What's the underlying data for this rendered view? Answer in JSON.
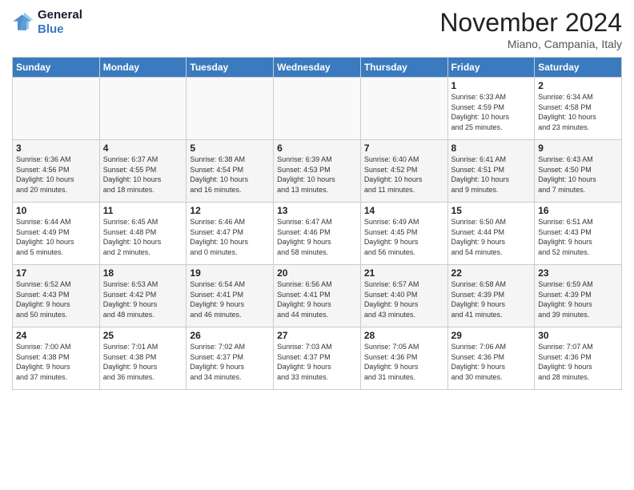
{
  "header": {
    "logo_line1": "General",
    "logo_line2": "Blue",
    "month_title": "November 2024",
    "location": "Miano, Campania, Italy"
  },
  "days_of_week": [
    "Sunday",
    "Monday",
    "Tuesday",
    "Wednesday",
    "Thursday",
    "Friday",
    "Saturday"
  ],
  "weeks": [
    [
      {
        "day": "",
        "info": ""
      },
      {
        "day": "",
        "info": ""
      },
      {
        "day": "",
        "info": ""
      },
      {
        "day": "",
        "info": ""
      },
      {
        "day": "",
        "info": ""
      },
      {
        "day": "1",
        "info": "Sunrise: 6:33 AM\nSunset: 4:59 PM\nDaylight: 10 hours\nand 25 minutes."
      },
      {
        "day": "2",
        "info": "Sunrise: 6:34 AM\nSunset: 4:58 PM\nDaylight: 10 hours\nand 23 minutes."
      }
    ],
    [
      {
        "day": "3",
        "info": "Sunrise: 6:36 AM\nSunset: 4:56 PM\nDaylight: 10 hours\nand 20 minutes."
      },
      {
        "day": "4",
        "info": "Sunrise: 6:37 AM\nSunset: 4:55 PM\nDaylight: 10 hours\nand 18 minutes."
      },
      {
        "day": "5",
        "info": "Sunrise: 6:38 AM\nSunset: 4:54 PM\nDaylight: 10 hours\nand 16 minutes."
      },
      {
        "day": "6",
        "info": "Sunrise: 6:39 AM\nSunset: 4:53 PM\nDaylight: 10 hours\nand 13 minutes."
      },
      {
        "day": "7",
        "info": "Sunrise: 6:40 AM\nSunset: 4:52 PM\nDaylight: 10 hours\nand 11 minutes."
      },
      {
        "day": "8",
        "info": "Sunrise: 6:41 AM\nSunset: 4:51 PM\nDaylight: 10 hours\nand 9 minutes."
      },
      {
        "day": "9",
        "info": "Sunrise: 6:43 AM\nSunset: 4:50 PM\nDaylight: 10 hours\nand 7 minutes."
      }
    ],
    [
      {
        "day": "10",
        "info": "Sunrise: 6:44 AM\nSunset: 4:49 PM\nDaylight: 10 hours\nand 5 minutes."
      },
      {
        "day": "11",
        "info": "Sunrise: 6:45 AM\nSunset: 4:48 PM\nDaylight: 10 hours\nand 2 minutes."
      },
      {
        "day": "12",
        "info": "Sunrise: 6:46 AM\nSunset: 4:47 PM\nDaylight: 10 hours\nand 0 minutes."
      },
      {
        "day": "13",
        "info": "Sunrise: 6:47 AM\nSunset: 4:46 PM\nDaylight: 9 hours\nand 58 minutes."
      },
      {
        "day": "14",
        "info": "Sunrise: 6:49 AM\nSunset: 4:45 PM\nDaylight: 9 hours\nand 56 minutes."
      },
      {
        "day": "15",
        "info": "Sunrise: 6:50 AM\nSunset: 4:44 PM\nDaylight: 9 hours\nand 54 minutes."
      },
      {
        "day": "16",
        "info": "Sunrise: 6:51 AM\nSunset: 4:43 PM\nDaylight: 9 hours\nand 52 minutes."
      }
    ],
    [
      {
        "day": "17",
        "info": "Sunrise: 6:52 AM\nSunset: 4:43 PM\nDaylight: 9 hours\nand 50 minutes."
      },
      {
        "day": "18",
        "info": "Sunrise: 6:53 AM\nSunset: 4:42 PM\nDaylight: 9 hours\nand 48 minutes."
      },
      {
        "day": "19",
        "info": "Sunrise: 6:54 AM\nSunset: 4:41 PM\nDaylight: 9 hours\nand 46 minutes."
      },
      {
        "day": "20",
        "info": "Sunrise: 6:56 AM\nSunset: 4:41 PM\nDaylight: 9 hours\nand 44 minutes."
      },
      {
        "day": "21",
        "info": "Sunrise: 6:57 AM\nSunset: 4:40 PM\nDaylight: 9 hours\nand 43 minutes."
      },
      {
        "day": "22",
        "info": "Sunrise: 6:58 AM\nSunset: 4:39 PM\nDaylight: 9 hours\nand 41 minutes."
      },
      {
        "day": "23",
        "info": "Sunrise: 6:59 AM\nSunset: 4:39 PM\nDaylight: 9 hours\nand 39 minutes."
      }
    ],
    [
      {
        "day": "24",
        "info": "Sunrise: 7:00 AM\nSunset: 4:38 PM\nDaylight: 9 hours\nand 37 minutes."
      },
      {
        "day": "25",
        "info": "Sunrise: 7:01 AM\nSunset: 4:38 PM\nDaylight: 9 hours\nand 36 minutes."
      },
      {
        "day": "26",
        "info": "Sunrise: 7:02 AM\nSunset: 4:37 PM\nDaylight: 9 hours\nand 34 minutes."
      },
      {
        "day": "27",
        "info": "Sunrise: 7:03 AM\nSunset: 4:37 PM\nDaylight: 9 hours\nand 33 minutes."
      },
      {
        "day": "28",
        "info": "Sunrise: 7:05 AM\nSunset: 4:36 PM\nDaylight: 9 hours\nand 31 minutes."
      },
      {
        "day": "29",
        "info": "Sunrise: 7:06 AM\nSunset: 4:36 PM\nDaylight: 9 hours\nand 30 minutes."
      },
      {
        "day": "30",
        "info": "Sunrise: 7:07 AM\nSunset: 4:36 PM\nDaylight: 9 hours\nand 28 minutes."
      }
    ]
  ]
}
